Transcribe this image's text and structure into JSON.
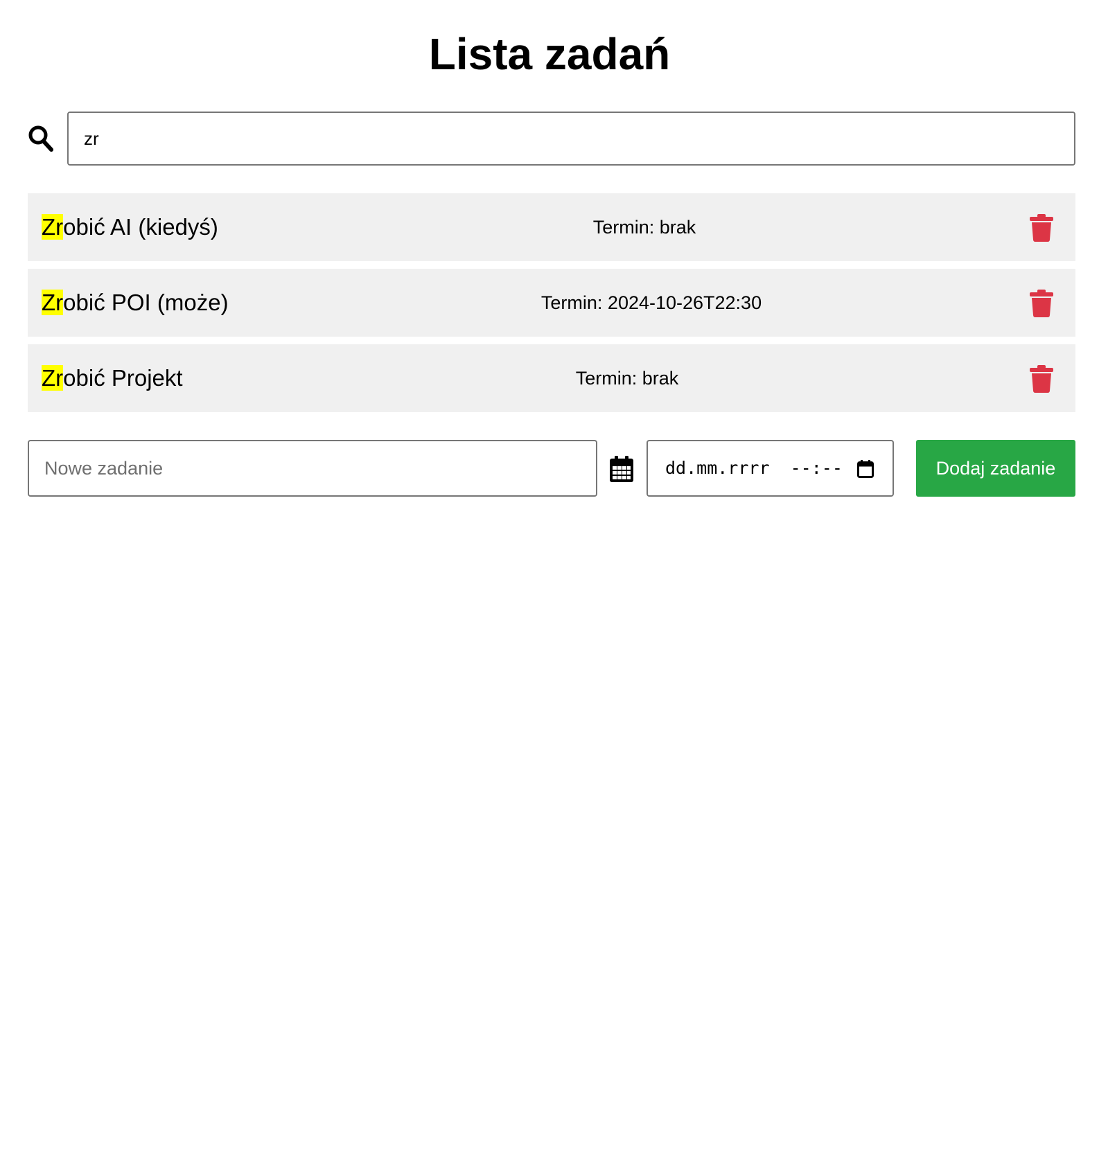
{
  "header": {
    "title": "Lista zadań"
  },
  "search": {
    "icon": "search-icon",
    "value": "zr"
  },
  "tasks": [
    {
      "match": "Zr",
      "rest": "obić AI (kiedyś)",
      "deadline": "Termin: brak"
    },
    {
      "match": "Zr",
      "rest": "obić POI (może)",
      "deadline": "Termin: 2024-10-26T22:30"
    },
    {
      "match": "Zr",
      "rest": "obić Projekt",
      "deadline": "Termin: brak"
    }
  ],
  "add_form": {
    "task_placeholder": "Nowe zadanie",
    "date_icon": "calendar-icon",
    "datetime_placeholder": "dd.mm.rrrr  --:--",
    "button_label": "Dodaj zadanie"
  },
  "colors": {
    "highlight": "#ffff00",
    "delete": "#dc3545",
    "add_button": "#28a745",
    "task_background": "#f0f0f0"
  }
}
